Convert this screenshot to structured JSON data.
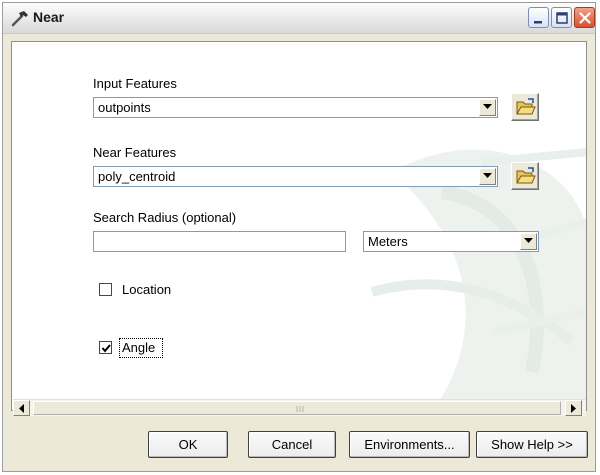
{
  "window": {
    "title": "Near",
    "title_icon": "hammer-icon",
    "controls": [
      "minimize-icon",
      "maximize-icon",
      "close-icon"
    ]
  },
  "form": {
    "input_features": {
      "label": "Input Features",
      "value": "outpoints",
      "browse_icon": "open-folder-icon"
    },
    "near_features": {
      "label": "Near Features",
      "value": "poly_centroid",
      "browse_icon": "open-folder-icon"
    },
    "search_radius": {
      "label": "Search Radius (optional)",
      "value": "",
      "unit": "Meters"
    },
    "location": {
      "label": "Location",
      "checked": false
    },
    "angle": {
      "label": "Angle",
      "checked": true
    }
  },
  "buttons": {
    "ok": "OK",
    "cancel": "Cancel",
    "environments": "Environments...",
    "show_help": "Show Help >>"
  },
  "colors": {
    "window_bg": "#ece9d8",
    "field_border": "#7f9db9",
    "close_button": "#d7502d"
  }
}
